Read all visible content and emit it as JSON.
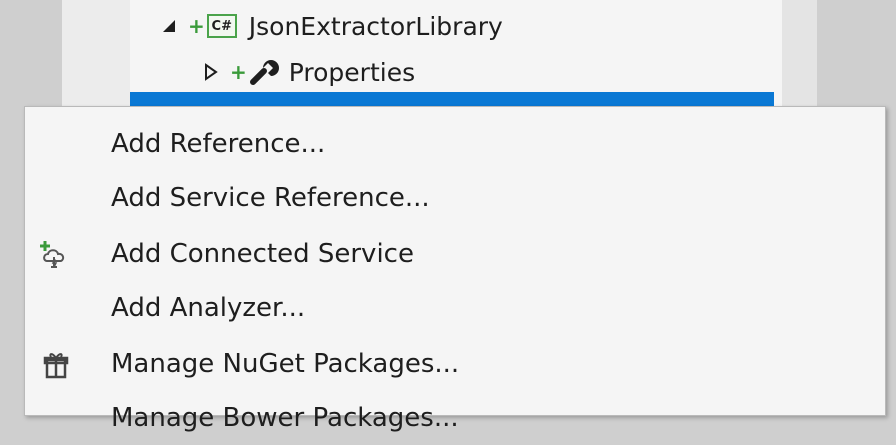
{
  "solution_explorer": {
    "project": {
      "label": "JsonExtractorLibrary",
      "icon": "csharp-project-icon",
      "icon_text": "C#",
      "plus": "+"
    },
    "properties": {
      "label": "Properties",
      "icon": "wrench-icon",
      "plus": "+"
    },
    "selection_color": "#0a78d4"
  },
  "context_menu": {
    "items": [
      {
        "label": "Add Reference...",
        "icon": null
      },
      {
        "label": "Add Service Reference...",
        "icon": null
      },
      {
        "label": "Add Connected Service",
        "icon": "connected-service-icon"
      },
      {
        "label": "Add Analyzer...",
        "icon": null
      },
      {
        "label": "Manage NuGet Packages...",
        "icon": "nuget-package-icon"
      },
      {
        "label": "Manage Bower Packages...",
        "icon": null
      }
    ]
  }
}
